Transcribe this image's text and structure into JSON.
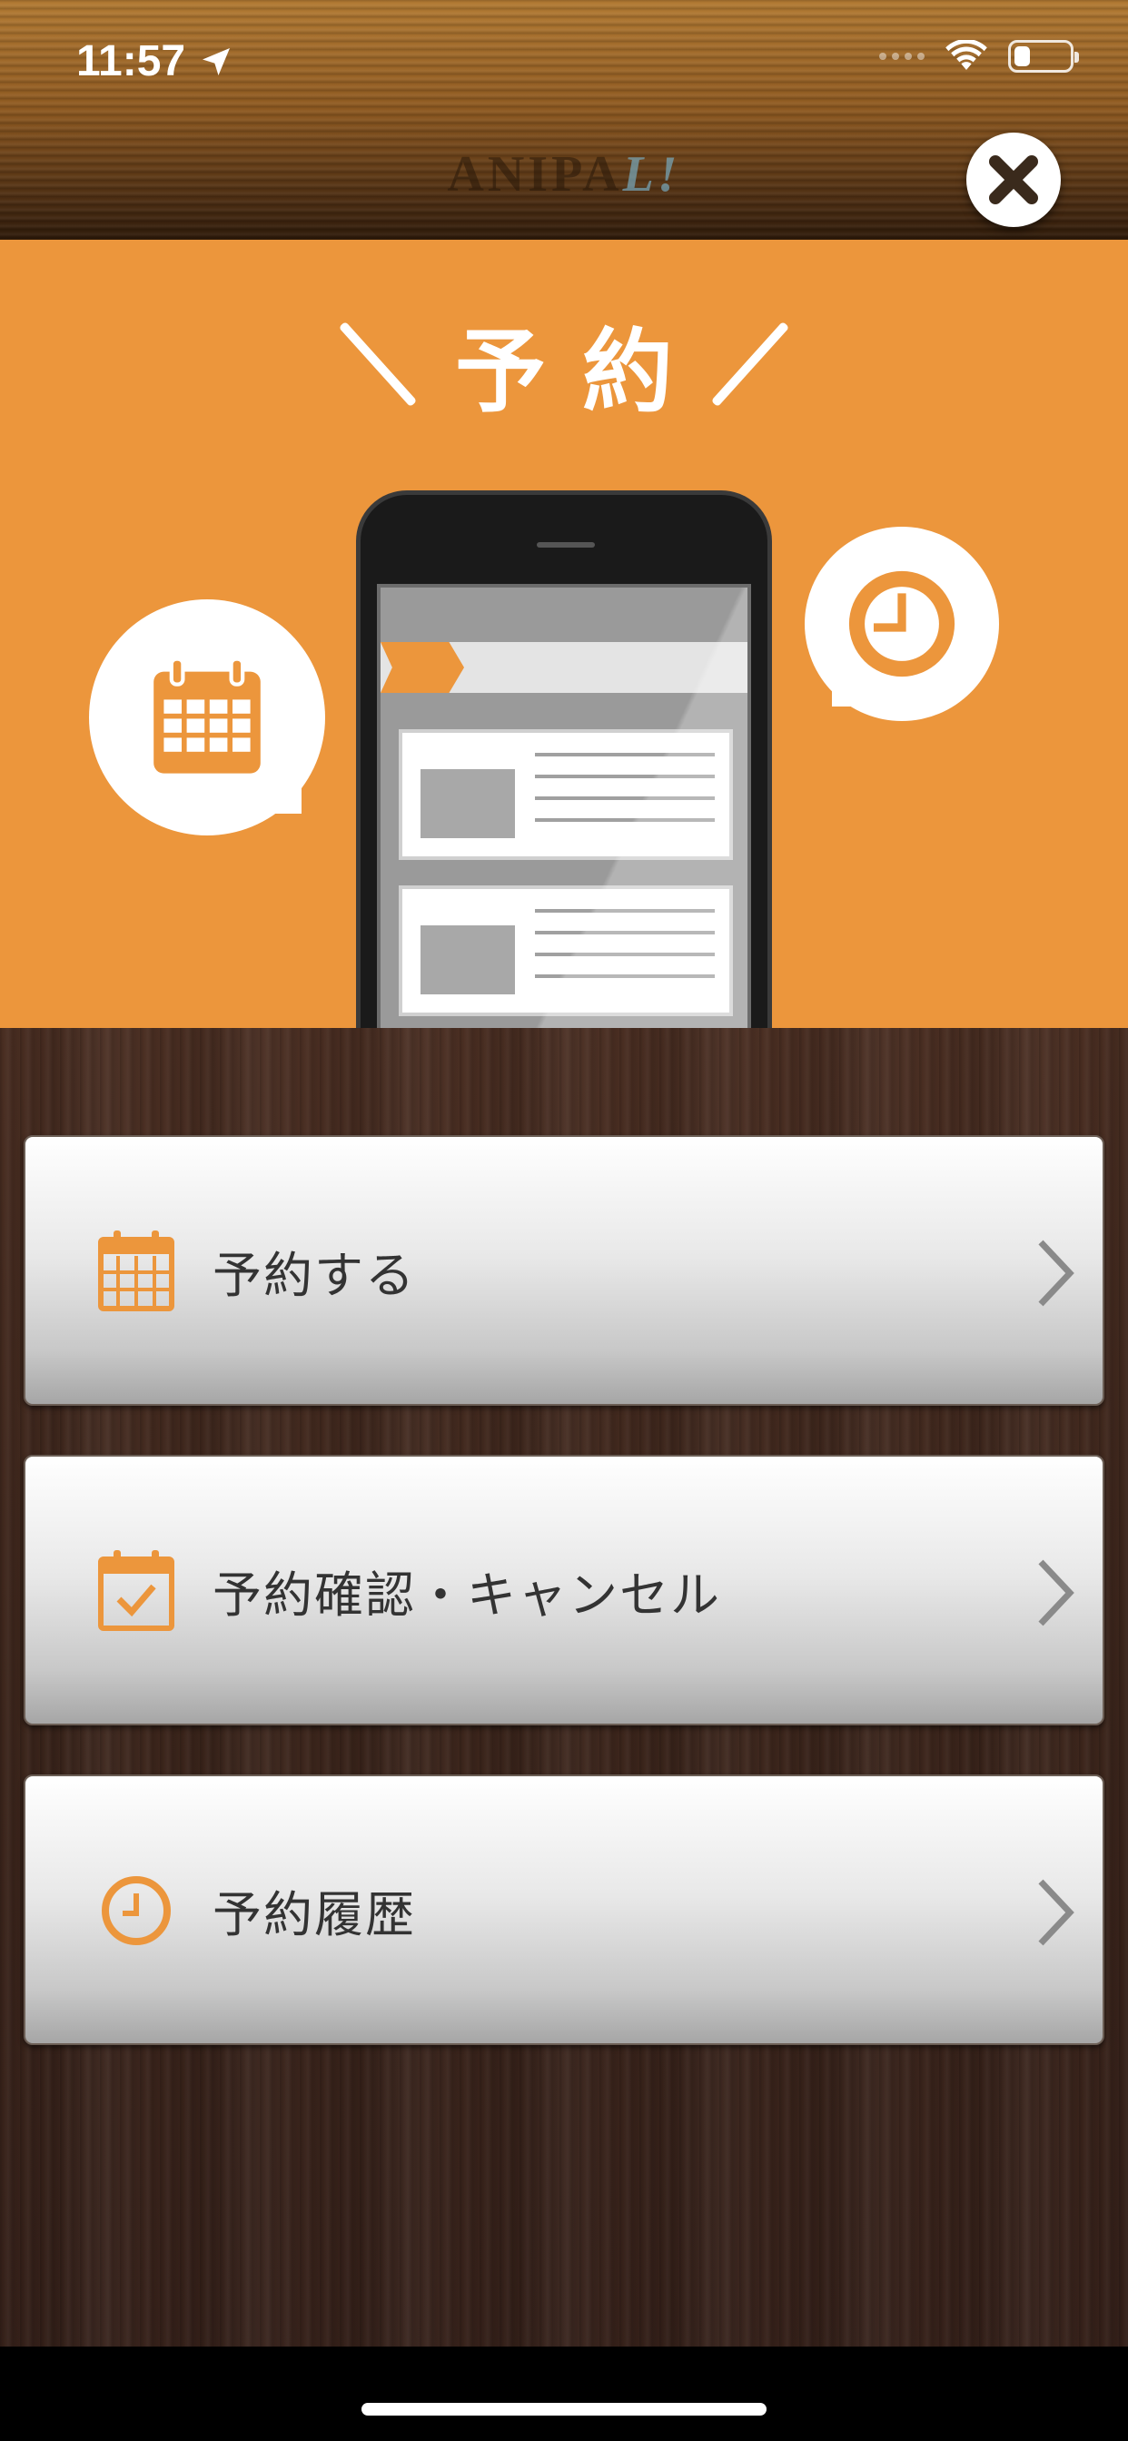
{
  "status_bar": {
    "time": "11:57",
    "battery_level_percent": 30
  },
  "header": {
    "brand_main": "ANIPA",
    "brand_accent": "L!",
    "close_icon": "close-x-icon"
  },
  "hero": {
    "title": "予約",
    "left_bubble_icon": "calendar-icon",
    "right_bubble_icon": "clock-icon",
    "illustration": "smartphone-icon"
  },
  "menu": {
    "items": [
      {
        "label": "予約する",
        "icon": "calendar-icon"
      },
      {
        "label": "予約確認・キャンセル",
        "icon": "calendar-check-icon"
      },
      {
        "label": "予約履歴",
        "icon": "clock-icon"
      }
    ]
  },
  "colors": {
    "accent_orange": "#ec963c",
    "menu_text": "#333333",
    "wood_dark": "#3d261c"
  }
}
